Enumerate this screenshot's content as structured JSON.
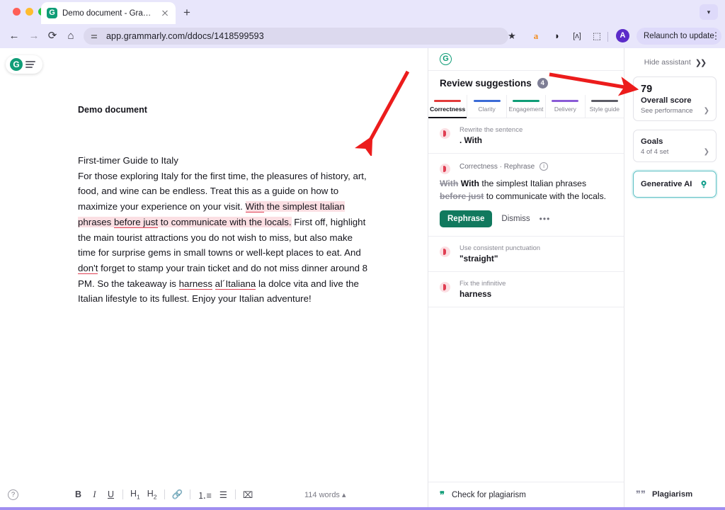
{
  "browser": {
    "tab": {
      "title": "Demo document - Grammarly",
      "favicon_letter": "G"
    },
    "new_tab_label": "+",
    "url": "app.grammarly.com/ddocs/1418599593",
    "toolbar_icons": [
      "bookmark-star-icon",
      "amazon-icon",
      "droplet-icon",
      "bracket-icon",
      "extensions-puzzle-icon"
    ],
    "avatar_letter": "A",
    "relaunch_label": "Relaunch to update",
    "colors": {
      "chrome_bg": "#e8e6fb",
      "url_bg": "#dcd9ee",
      "accent_purple": "#a08ef0"
    }
  },
  "editor": {
    "doc_title": "Demo document",
    "paragraphs": {
      "heading": "First-timer Guide to Italy",
      "line1": "For those exploring Italy for the first time, the pleasures of history, art,",
      "line2": "food, and wine can be endless. Treat this as a guide on how to maximize",
      "line3_plain": "your experience on your visit. ",
      "line3_hl_a": "With",
      "line3_hl_b": " the simplest Italian phrases ",
      "line3_hl_c": "before just",
      "line4_hl": "to communicate with the locals.",
      "line4_plain": " First off, highlight the main tourist",
      "line5": "attractions you do not wish to miss, but also make time for surprise gems",
      "line6_a": "in small towns or well-kept places to eat. And ",
      "line6_err": "don't",
      "line6_b": " forget to stamp your",
      "line7": "train ticket and do not miss dinner around 8 PM. So the takeaway is",
      "line8_err1": "harness",
      "line8_err2": "al´Italiana",
      "line8_rest": " la dolce vita and live the Italian lifestyle to its fullest.",
      "line9": "Enjoy your Italian adventure!"
    },
    "toolbar": {
      "bold": "B",
      "italic": "I",
      "underline": "U",
      "h1": "H",
      "h1_sub": "1",
      "h2": "H",
      "h2_sub": "2",
      "link": "🔗",
      "ordered_list": "list-ordered-icon",
      "bullet_list": "list-bullet-icon",
      "clear_format": "clear-format-icon",
      "word_count": "114 words"
    }
  },
  "suggestions": {
    "header_logo": "G",
    "title": "Review suggestions",
    "count": "4",
    "tabs": [
      {
        "label": "Correctness",
        "color": "#e23a3a",
        "active": true
      },
      {
        "label": "Clarity",
        "color": "#3b6bd6",
        "active": false
      },
      {
        "label": "Engagement",
        "color": "#0f9d77",
        "active": false
      },
      {
        "label": "Delivery",
        "color": "#8a5bd6",
        "active": false
      },
      {
        "label": "Style guide",
        "color": "#5c5c66",
        "active": false
      }
    ],
    "cards": [
      {
        "category": "Rewrite the sentence",
        "text": ". With"
      }
    ],
    "open_card": {
      "category": "Correctness · Rephrase",
      "strike1": "With",
      "insert1": "With",
      "mid": " the simplest Italian phrases ",
      "strike2": "before just",
      "tail": " to communicate with the locals.",
      "primary_label": "Rephrase",
      "dismiss_label": "Dismiss",
      "more_label": "•••"
    },
    "cards_after": [
      {
        "category": "Use consistent punctuation",
        "text": "\"straight\""
      },
      {
        "category": "Fix the infinitive",
        "text": "harness"
      }
    ],
    "plagiarism_label": "Check for plagiarism"
  },
  "assistant": {
    "hide_label": "Hide assistant",
    "score_value": "79",
    "score_label": "Overall score",
    "score_sub": "See performance",
    "goals_label": "Goals",
    "goals_sub": "4 of 4 set",
    "generative_ai_label": "Generative AI",
    "plagiarism_label": "Plagiarism",
    "colors": {
      "ai_border": "#5bbfc4",
      "bulb": "#0f9d8a"
    }
  },
  "annotations": {
    "arrow_color": "#ec1c1c",
    "arrow1": "points from upper-right down-left to highlighted sentence",
    "arrow2": "points right toward overall score card"
  }
}
